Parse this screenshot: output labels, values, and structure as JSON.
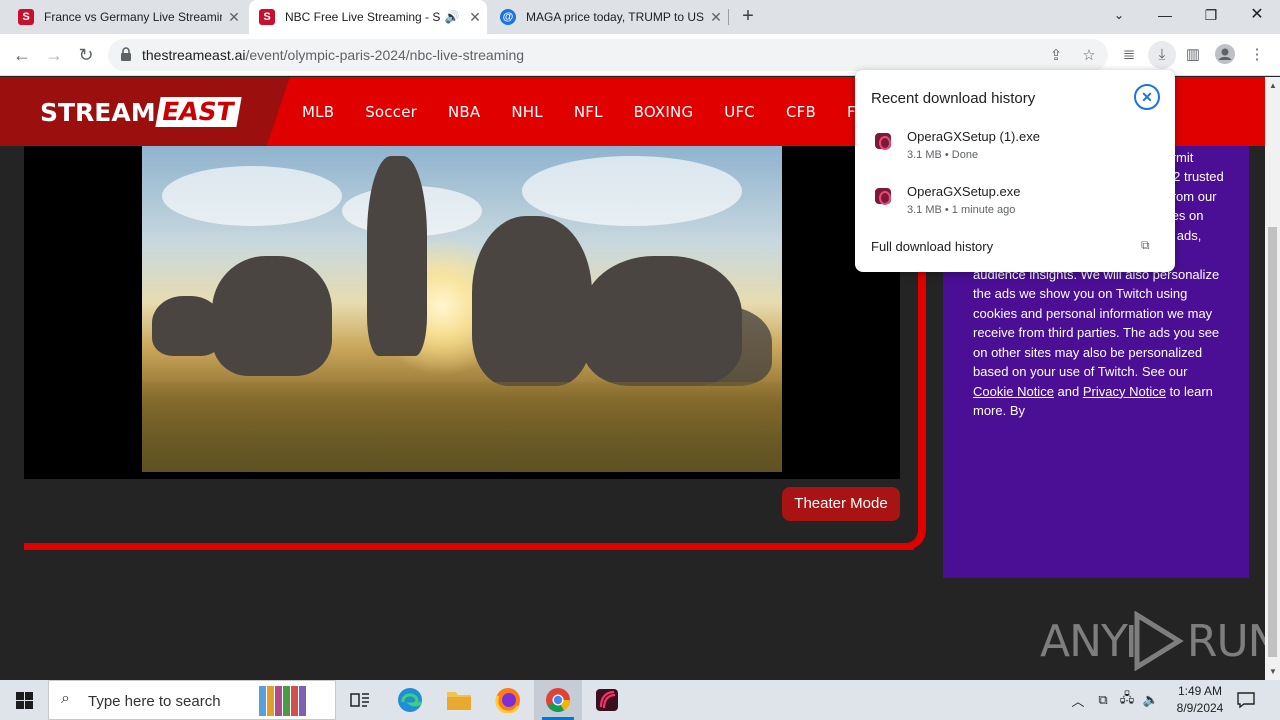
{
  "browser": {
    "tabs": [
      {
        "title": "France vs Germany Live Streamin",
        "favicon": "S",
        "favicon_color": "#c8102e",
        "active": false
      },
      {
        "title": "NBC Free Live Streaming - S",
        "favicon": "S",
        "favicon_color": "#c8102e",
        "active": true
      },
      {
        "title": "MAGA price today, TRUMP to US",
        "favicon": "@",
        "favicon_color": "#1a73e8",
        "active": false
      }
    ],
    "url_host": "thestreameast.ai",
    "url_path": "/event/olympic-paris-2024/nbc-live-streaming"
  },
  "site": {
    "logo_left": "STREAM",
    "logo_right": "EAST",
    "menu": [
      "MLB",
      "Soccer",
      "NBA",
      "NHL",
      "NFL",
      "BOXING",
      "UFC",
      "CFB",
      "F1"
    ],
    "theater_button": "Theater Mode",
    "consent_text_before": ", e zed , cts, of campaigns to acquire new users. If you agree, we will also permit other Amazon services and up to 12 trusted third party partners to obtain data from our services or store and access cookies on your device to deliver personalized ads, measure effectiveness, and create audience insights. We will also personalize the ads we show you on Twitch using cookies and personal information we may receive from third parties. The ads you see on other sites may also be personalized based on your use of Twitch. See our ",
    "consent_link1": "Cookie Notice",
    "consent_mid": " and ",
    "consent_link2": "Privacy Notice",
    "consent_after": " to learn more. By"
  },
  "downloads": {
    "header": "Recent download history",
    "items": [
      {
        "name": "OperaGXSetup (1).exe",
        "meta": "3.1 MB • Done"
      },
      {
        "name": "OperaGXSetup.exe",
        "meta": "3.1 MB • 1 minute ago"
      }
    ],
    "full_history": "Full download history"
  },
  "watermark": {
    "left": "ANY",
    "right": "RUN"
  },
  "taskbar": {
    "search_placeholder": "Type here to search",
    "time": "1:49 AM",
    "date": "8/9/2024"
  },
  "colors": {
    "nav_red": "#e00000",
    "logo_dark_red": "#9c0f0f",
    "consent_purple": "#4b0f96",
    "accent_blue": "#1a73e8"
  }
}
